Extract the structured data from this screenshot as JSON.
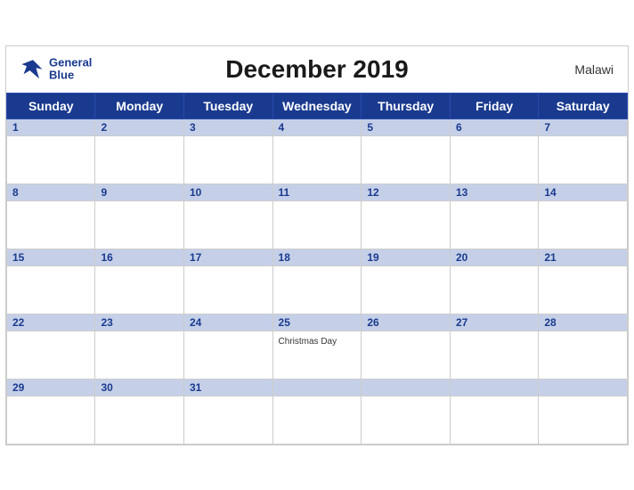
{
  "header": {
    "title": "December 2019",
    "country": "Malawi",
    "logo": {
      "line1": "General",
      "line2": "Blue"
    }
  },
  "days_of_week": [
    "Sunday",
    "Monday",
    "Tuesday",
    "Wednesday",
    "Thursday",
    "Friday",
    "Saturday"
  ],
  "weeks": [
    [
      {
        "date": "1",
        "holiday": ""
      },
      {
        "date": "2",
        "holiday": ""
      },
      {
        "date": "3",
        "holiday": ""
      },
      {
        "date": "4",
        "holiday": ""
      },
      {
        "date": "5",
        "holiday": ""
      },
      {
        "date": "6",
        "holiday": ""
      },
      {
        "date": "7",
        "holiday": ""
      }
    ],
    [
      {
        "date": "8",
        "holiday": ""
      },
      {
        "date": "9",
        "holiday": ""
      },
      {
        "date": "10",
        "holiday": ""
      },
      {
        "date": "11",
        "holiday": ""
      },
      {
        "date": "12",
        "holiday": ""
      },
      {
        "date": "13",
        "holiday": ""
      },
      {
        "date": "14",
        "holiday": ""
      }
    ],
    [
      {
        "date": "15",
        "holiday": ""
      },
      {
        "date": "16",
        "holiday": ""
      },
      {
        "date": "17",
        "holiday": ""
      },
      {
        "date": "18",
        "holiday": ""
      },
      {
        "date": "19",
        "holiday": ""
      },
      {
        "date": "20",
        "holiday": ""
      },
      {
        "date": "21",
        "holiday": ""
      }
    ],
    [
      {
        "date": "22",
        "holiday": ""
      },
      {
        "date": "23",
        "holiday": ""
      },
      {
        "date": "24",
        "holiday": ""
      },
      {
        "date": "25",
        "holiday": "Christmas Day"
      },
      {
        "date": "26",
        "holiday": ""
      },
      {
        "date": "27",
        "holiday": ""
      },
      {
        "date": "28",
        "holiday": ""
      }
    ],
    [
      {
        "date": "29",
        "holiday": ""
      },
      {
        "date": "30",
        "holiday": ""
      },
      {
        "date": "31",
        "holiday": ""
      },
      {
        "date": "",
        "holiday": ""
      },
      {
        "date": "",
        "holiday": ""
      },
      {
        "date": "",
        "holiday": ""
      },
      {
        "date": "",
        "holiday": ""
      }
    ]
  ]
}
